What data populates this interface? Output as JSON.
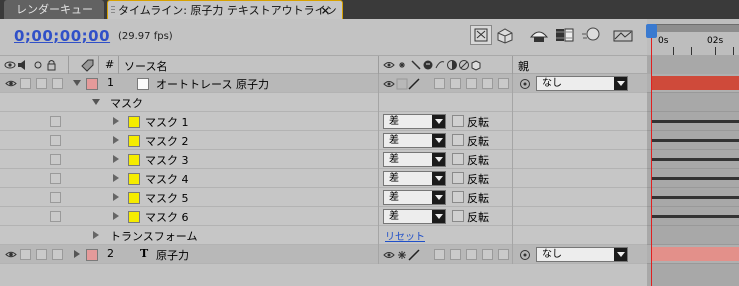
{
  "tabs": {
    "render_queue": "レンダーキュー",
    "timeline": "タイムライン: 原子力 テキストアウトライン",
    "close_glyph": "×"
  },
  "header": {
    "timecode": "0;00;00;00",
    "fps": "(29.97 fps)"
  },
  "columns": {
    "number": "#",
    "source_name": "ソース名",
    "parent": "親"
  },
  "layers": [
    {
      "index": "1",
      "name": "オートトレース 原子力",
      "parent": "なし",
      "label_color": "#e49a9a"
    },
    {
      "index": "2",
      "name": "原子力",
      "type_glyph": "T",
      "parent": "なし",
      "label_color": "#e49a9a"
    }
  ],
  "mask_group": {
    "label": "マスク",
    "masks": [
      {
        "name": "マスク 1",
        "mode": "差",
        "invert": "反転"
      },
      {
        "name": "マスク 2",
        "mode": "差",
        "invert": "反転"
      },
      {
        "name": "マスク 3",
        "mode": "差",
        "invert": "反転"
      },
      {
        "name": "マスク 4",
        "mode": "差",
        "invert": "反転"
      },
      {
        "name": "マスク 5",
        "mode": "差",
        "invert": "反転"
      },
      {
        "name": "マスク 6",
        "mode": "差",
        "invert": "反転"
      }
    ]
  },
  "transform": {
    "label": "トランスフォーム",
    "reset": "リセット"
  },
  "timeline": {
    "ticks": [
      "0s",
      "02s"
    ],
    "colors": {
      "selected_layer_bar": "#cf4a3a",
      "layer_bar": "#e3908a",
      "playhead": "#e02020",
      "timecode": "#3050c8"
    }
  }
}
